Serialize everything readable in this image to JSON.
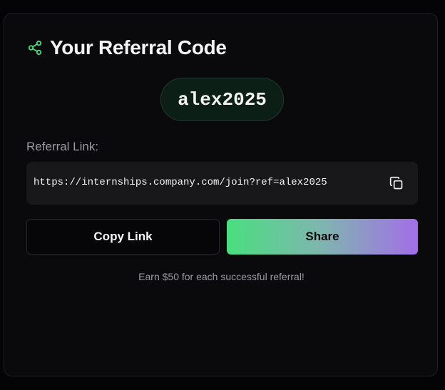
{
  "card": {
    "title": "Your Referral Code",
    "title_icon": "share-icon",
    "accent_color": "#4ade80"
  },
  "code": {
    "value": "alex2025"
  },
  "link": {
    "label": "Referral Link:",
    "url": "https://internships.company.com/join?ref=alex2025",
    "copy_icon": "copy-icon"
  },
  "actions": {
    "copy_label": "Copy Link",
    "share_label": "Share",
    "share_gradient": [
      "#4ade80",
      "#a36ee8"
    ]
  },
  "footnote": "Earn $50 for each successful referral!"
}
